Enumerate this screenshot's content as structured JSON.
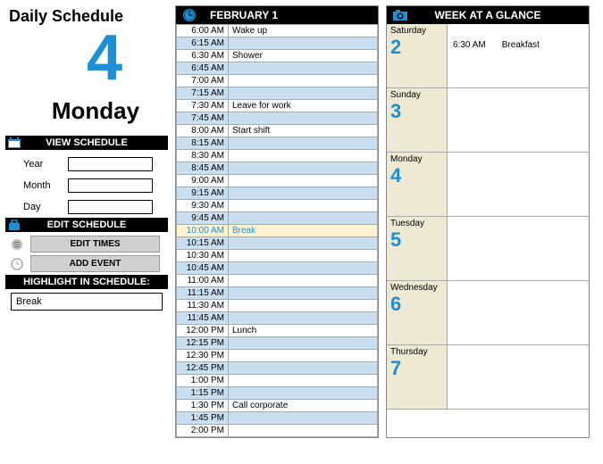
{
  "title": "Daily Schedule",
  "bigNum": "4",
  "dayName": "Monday",
  "viewSchedule": {
    "header": "VIEW SCHEDULE",
    "yearLabel": "Year",
    "monthLabel": "Month",
    "dayLabel": "Day",
    "yearVal": "",
    "monthVal": "",
    "dayVal": ""
  },
  "editSchedule": {
    "header": "EDIT SCHEDULE",
    "editTimes": "EDIT TIMES",
    "addEvent": "ADD EVENT"
  },
  "highlight": {
    "header": "HIGHLIGHT IN SCHEDULE:",
    "value": "Break"
  },
  "schedule": {
    "header": "FEBRUARY 1",
    "rows": [
      {
        "t": "6:00 AM",
        "e": "Wake up",
        "alt": false
      },
      {
        "t": "6:15 AM",
        "e": "",
        "alt": true
      },
      {
        "t": "6:30 AM",
        "e": "Shower",
        "alt": false
      },
      {
        "t": "6:45 AM",
        "e": "",
        "alt": true
      },
      {
        "t": "7:00 AM",
        "e": "",
        "alt": false
      },
      {
        "t": "7:15 AM",
        "e": "",
        "alt": true
      },
      {
        "t": "7:30 AM",
        "e": "Leave for work",
        "alt": false
      },
      {
        "t": "7:45 AM",
        "e": "",
        "alt": true
      },
      {
        "t": "8:00 AM",
        "e": "Start shift",
        "alt": false
      },
      {
        "t": "8:15 AM",
        "e": "",
        "alt": true
      },
      {
        "t": "8:30 AM",
        "e": "",
        "alt": false
      },
      {
        "t": "8:45 AM",
        "e": "",
        "alt": true
      },
      {
        "t": "9:00 AM",
        "e": "",
        "alt": false
      },
      {
        "t": "9:15 AM",
        "e": "",
        "alt": true
      },
      {
        "t": "9:30 AM",
        "e": "",
        "alt": false
      },
      {
        "t": "9:45 AM",
        "e": "",
        "alt": true
      },
      {
        "t": "10:00 AM",
        "e": "Break",
        "alt": false,
        "hl": true
      },
      {
        "t": "10:15 AM",
        "e": "",
        "alt": true
      },
      {
        "t": "10:30 AM",
        "e": "",
        "alt": false
      },
      {
        "t": "10:45 AM",
        "e": "",
        "alt": true
      },
      {
        "t": "11:00 AM",
        "e": "",
        "alt": false
      },
      {
        "t": "11:15 AM",
        "e": "",
        "alt": true
      },
      {
        "t": "11:30 AM",
        "e": "",
        "alt": false
      },
      {
        "t": "11:45 AM",
        "e": "",
        "alt": true
      },
      {
        "t": "12:00 PM",
        "e": "Lunch",
        "alt": false
      },
      {
        "t": "12:15 PM",
        "e": "",
        "alt": true
      },
      {
        "t": "12:30 PM",
        "e": "",
        "alt": false
      },
      {
        "t": "12:45 PM",
        "e": "",
        "alt": true
      },
      {
        "t": "1:00 PM",
        "e": "",
        "alt": false
      },
      {
        "t": "1:15 PM",
        "e": "",
        "alt": true
      },
      {
        "t": "1:30 PM",
        "e": "Call corporate",
        "alt": false
      },
      {
        "t": "1:45 PM",
        "e": "",
        "alt": true
      },
      {
        "t": "2:00 PM",
        "e": "",
        "alt": false
      }
    ]
  },
  "week": {
    "header": "WEEK AT A GLANCE",
    "days": [
      {
        "name": "Saturday",
        "num": "2",
        "events": [
          {
            "t": "6:30 AM",
            "e": "Breakfast"
          }
        ]
      },
      {
        "name": "Sunday",
        "num": "3",
        "events": []
      },
      {
        "name": "Monday",
        "num": "4",
        "events": []
      },
      {
        "name": "Tuesday",
        "num": "5",
        "events": []
      },
      {
        "name": "Wednesday",
        "num": "6",
        "events": []
      },
      {
        "name": "Thursday",
        "num": "7",
        "events": []
      }
    ]
  }
}
